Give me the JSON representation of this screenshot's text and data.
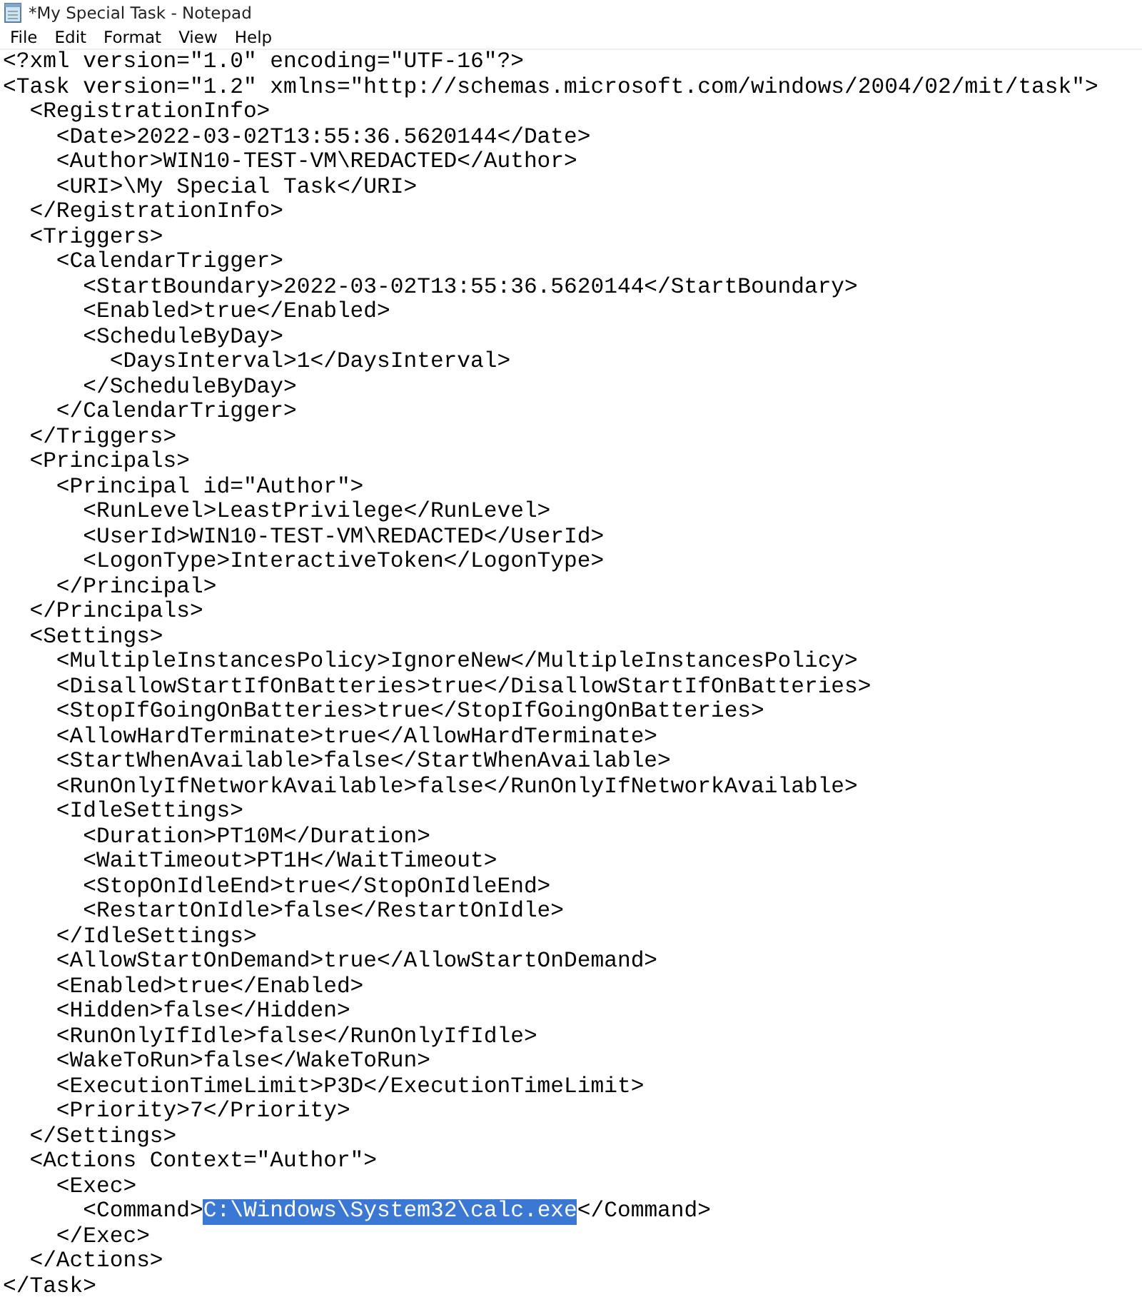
{
  "window": {
    "title": "*My Special Task - Notepad"
  },
  "menu": [
    "File",
    "Edit",
    "Format",
    "View",
    "Help"
  ],
  "lines": [
    {
      "segments": [
        {
          "text": "<?xml version=\"1.0\" encoding=\"UTF-16\"?>",
          "selected": false
        }
      ]
    },
    {
      "segments": [
        {
          "text": "<Task version=\"1.2\" xmlns=\"http://schemas.microsoft.com/windows/2004/02/mit/task\">",
          "selected": false
        }
      ]
    },
    {
      "segments": [
        {
          "text": "  <RegistrationInfo>",
          "selected": false
        }
      ]
    },
    {
      "segments": [
        {
          "text": "    <Date>2022-03-02T13:55:36.5620144</Date>",
          "selected": false
        }
      ]
    },
    {
      "segments": [
        {
          "text": "    <Author>WIN10-TEST-VM\\REDACTED</Author>",
          "selected": false
        }
      ]
    },
    {
      "segments": [
        {
          "text": "    <URI>\\My Special Task</URI>",
          "selected": false
        }
      ]
    },
    {
      "segments": [
        {
          "text": "  </RegistrationInfo>",
          "selected": false
        }
      ]
    },
    {
      "segments": [
        {
          "text": "  <Triggers>",
          "selected": false
        }
      ]
    },
    {
      "segments": [
        {
          "text": "    <CalendarTrigger>",
          "selected": false
        }
      ]
    },
    {
      "segments": [
        {
          "text": "      <StartBoundary>2022-03-02T13:55:36.5620144</StartBoundary>",
          "selected": false
        }
      ]
    },
    {
      "segments": [
        {
          "text": "      <Enabled>true</Enabled>",
          "selected": false
        }
      ]
    },
    {
      "segments": [
        {
          "text": "      <ScheduleByDay>",
          "selected": false
        }
      ]
    },
    {
      "segments": [
        {
          "text": "        <DaysInterval>1</DaysInterval>",
          "selected": false
        }
      ]
    },
    {
      "segments": [
        {
          "text": "      </ScheduleByDay>",
          "selected": false
        }
      ]
    },
    {
      "segments": [
        {
          "text": "    </CalendarTrigger>",
          "selected": false
        }
      ]
    },
    {
      "segments": [
        {
          "text": "  </Triggers>",
          "selected": false
        }
      ]
    },
    {
      "segments": [
        {
          "text": "  <Principals>",
          "selected": false
        }
      ]
    },
    {
      "segments": [
        {
          "text": "    <Principal id=\"Author\">",
          "selected": false
        }
      ]
    },
    {
      "segments": [
        {
          "text": "      <RunLevel>LeastPrivilege</RunLevel>",
          "selected": false
        }
      ]
    },
    {
      "segments": [
        {
          "text": "      <UserId>WIN10-TEST-VM\\REDACTED</UserId>",
          "selected": false
        }
      ]
    },
    {
      "segments": [
        {
          "text": "      <LogonType>InteractiveToken</LogonType>",
          "selected": false
        }
      ]
    },
    {
      "segments": [
        {
          "text": "    </Principal>",
          "selected": false
        }
      ]
    },
    {
      "segments": [
        {
          "text": "  </Principals>",
          "selected": false
        }
      ]
    },
    {
      "segments": [
        {
          "text": "  <Settings>",
          "selected": false
        }
      ]
    },
    {
      "segments": [
        {
          "text": "    <MultipleInstancesPolicy>IgnoreNew</MultipleInstancesPolicy>",
          "selected": false
        }
      ]
    },
    {
      "segments": [
        {
          "text": "    <DisallowStartIfOnBatteries>true</DisallowStartIfOnBatteries>",
          "selected": false
        }
      ]
    },
    {
      "segments": [
        {
          "text": "    <StopIfGoingOnBatteries>true</StopIfGoingOnBatteries>",
          "selected": false
        }
      ]
    },
    {
      "segments": [
        {
          "text": "    <AllowHardTerminate>true</AllowHardTerminate>",
          "selected": false
        }
      ]
    },
    {
      "segments": [
        {
          "text": "    <StartWhenAvailable>false</StartWhenAvailable>",
          "selected": false
        }
      ]
    },
    {
      "segments": [
        {
          "text": "    <RunOnlyIfNetworkAvailable>false</RunOnlyIfNetworkAvailable>",
          "selected": false
        }
      ]
    },
    {
      "segments": [
        {
          "text": "    <IdleSettings>",
          "selected": false
        }
      ]
    },
    {
      "segments": [
        {
          "text": "      <Duration>PT10M</Duration>",
          "selected": false
        }
      ]
    },
    {
      "segments": [
        {
          "text": "      <WaitTimeout>PT1H</WaitTimeout>",
          "selected": false
        }
      ]
    },
    {
      "segments": [
        {
          "text": "      <StopOnIdleEnd>true</StopOnIdleEnd>",
          "selected": false
        }
      ]
    },
    {
      "segments": [
        {
          "text": "      <RestartOnIdle>false</RestartOnIdle>",
          "selected": false
        }
      ]
    },
    {
      "segments": [
        {
          "text": "    </IdleSettings>",
          "selected": false
        }
      ]
    },
    {
      "segments": [
        {
          "text": "    <AllowStartOnDemand>true</AllowStartOnDemand>",
          "selected": false
        }
      ]
    },
    {
      "segments": [
        {
          "text": "    <Enabled>true</Enabled>",
          "selected": false
        }
      ]
    },
    {
      "segments": [
        {
          "text": "    <Hidden>false</Hidden>",
          "selected": false
        }
      ]
    },
    {
      "segments": [
        {
          "text": "    <RunOnlyIfIdle>false</RunOnlyIfIdle>",
          "selected": false
        }
      ]
    },
    {
      "segments": [
        {
          "text": "    <WakeToRun>false</WakeToRun>",
          "selected": false
        }
      ]
    },
    {
      "segments": [
        {
          "text": "    <ExecutionTimeLimit>P3D</ExecutionTimeLimit>",
          "selected": false
        }
      ]
    },
    {
      "segments": [
        {
          "text": "    <Priority>7</Priority>",
          "selected": false
        }
      ]
    },
    {
      "segments": [
        {
          "text": "  </Settings>",
          "selected": false
        }
      ]
    },
    {
      "segments": [
        {
          "text": "  <Actions Context=\"Author\">",
          "selected": false
        }
      ]
    },
    {
      "segments": [
        {
          "text": "    <Exec>",
          "selected": false
        }
      ]
    },
    {
      "segments": [
        {
          "text": "      <Command>",
          "selected": false
        },
        {
          "text": "C:\\Windows\\System32\\calc.exe",
          "selected": true
        },
        {
          "text": "</Command>",
          "selected": false
        }
      ]
    },
    {
      "segments": [
        {
          "text": "    </Exec>",
          "selected": false
        }
      ]
    },
    {
      "segments": [
        {
          "text": "  </Actions>",
          "selected": false
        }
      ]
    },
    {
      "segments": [
        {
          "text": "</Task>",
          "selected": false
        }
      ]
    }
  ]
}
